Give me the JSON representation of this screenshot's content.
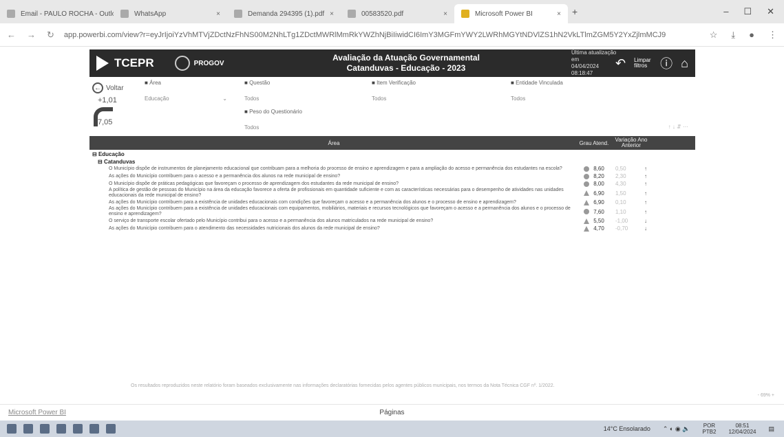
{
  "browser": {
    "tabs": [
      {
        "label": "Email - PAULO ROCHA - Outlo",
        "icon": "outlook-icon"
      },
      {
        "label": "WhatsApp",
        "icon": "whatsapp-icon"
      },
      {
        "label": "Demanda 294395 (1).pdf",
        "icon": "pdf-icon"
      },
      {
        "label": "00583520.pdf",
        "icon": "pdf-icon"
      },
      {
        "label": "Microsoft Power BI",
        "icon": "powerbi-icon",
        "active": true
      }
    ],
    "new_tab": "+",
    "url": "app.powerbi.com/view?r=eyJrIjoiYzVhMTVjZDctNzFhNS00M2NhLTg1ZDctMWRlMmRkYWZhNjBiIiwidCI6ImY3MGFmYWY2LWRhMGYtNDVlZS1hN2VkLTlmZGM5Y2YxZjlmMCJ9"
  },
  "report": {
    "header": {
      "logo": "TCEPR",
      "brand": "PROGOV",
      "title_line1": "Avaliação da Atuação Governamental",
      "title_line2": "Catanduvas - Educação - 2023",
      "update_label": "Última atualização em",
      "update_date": "04/04/2024 08:18:47",
      "limpar": "Limpar filtros"
    },
    "voltar": "Voltar",
    "num1": "+1,01",
    "num2": "7,05",
    "filters": {
      "area": {
        "label": "Área",
        "value": "Educação"
      },
      "questao": {
        "label": "Questão",
        "value": "Todos"
      },
      "item": {
        "label": "Item Verificação",
        "value": "Todos"
      },
      "entidade": {
        "label": "Entidade Vinculada",
        "value": "Todos"
      },
      "peso": {
        "label": "Peso do Questionário",
        "value": "Todos"
      }
    },
    "table": {
      "col_area": "Área",
      "col_grau": "Grau Atend.",
      "col_var": "Variação Ano Anterior",
      "group": "Educação",
      "subgroup": "Catanduvas",
      "rows": [
        {
          "q": "O Município dispõe de instrumentos de planejamento educacional que contribuam para a melhoria do processo de ensino e aprendizagem e para a ampliação do acesso e permanência dos estudantes na escola?",
          "grau": "8,60",
          "var": "0,50",
          "dir": "up",
          "shape": "circle"
        },
        {
          "q": "As ações do Município contribuem para o acesso e a permanência dos alunos na rede municipal de ensino?",
          "grau": "8,20",
          "var": "2,30",
          "dir": "up",
          "shape": "circle"
        },
        {
          "q": "O Município dispõe de práticas pedagógicas que favoreçam o processo de aprendizagem dos estudantes da rede municipal de ensino?",
          "grau": "8,00",
          "var": "4,30",
          "dir": "up",
          "shape": "circle"
        },
        {
          "q": "A política de gestão de pessoas do Município na área da educação favorece a oferta de profissionais em quantidade suficiente e com as características necessárias para o desempenho de atividades nas unidades educacionais da rede municipal de ensino?",
          "grau": "6,90",
          "var": "1,50",
          "dir": "up",
          "shape": "triangle"
        },
        {
          "q": "As ações do Município contribuem para a existência de unidades educacionais com condições que favoreçam o acesso e a permanência dos alunos e o processo de ensino e aprendizagem?",
          "grau": "6,90",
          "var": "0,10",
          "dir": "up",
          "shape": "triangle"
        },
        {
          "q": "As ações do Município contribuem para a existência de unidades educacionais com equipamentos, mobiliários, materiais e recursos tecnológicos que favoreçam o acesso e a permanência dos alunos e o processo de ensino e aprendizagem?",
          "grau": "7,60",
          "var": "1,10",
          "dir": "up",
          "shape": "circle"
        },
        {
          "q": "O serviço de transporte escolar ofertado pelo Município contribui para o acesso e a permanência dos alunos matriculados na rede municipal de ensino?",
          "grau": "5,50",
          "var": "-1,00",
          "dir": "down",
          "shape": "triangle"
        },
        {
          "q": "As ações do Município contribuem para o atendimento das necessidades nutricionais dos alunos da rede municipal de ensino?",
          "grau": "4,70",
          "var": "-0,70",
          "dir": "down",
          "shape": "triangle"
        }
      ]
    },
    "footnote": "Os resultados reproduzidos neste relatório foram baseados exclusivamente nas informações declaratórias fornecidas pelos agentes públicos municipais, nos termos da Nota Técnica CGF nº. 1/2022.",
    "zoom": "- 69% +"
  },
  "bottom": {
    "powerbi": "Microsoft Power BI",
    "paginas": "Páginas"
  },
  "taskbar": {
    "weather": "14°C Ensolarado",
    "lang1": "POR",
    "lang2": "PTB2",
    "time": "08:51",
    "date": "12/04/2024"
  }
}
